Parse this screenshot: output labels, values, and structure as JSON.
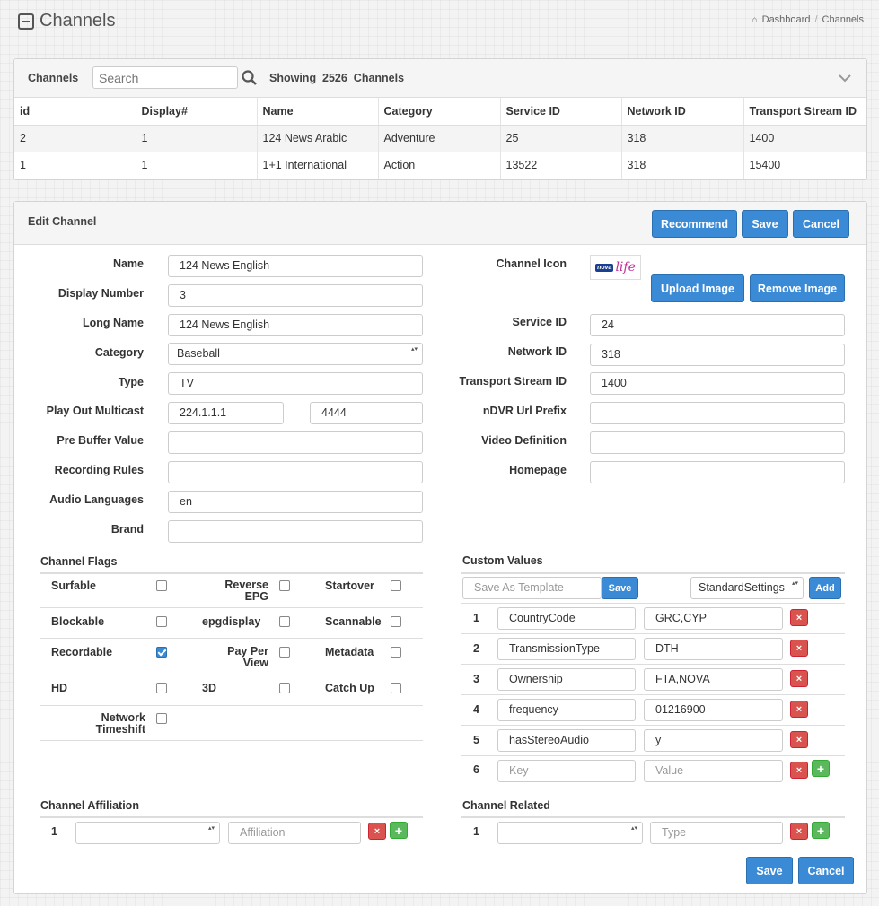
{
  "page": {
    "title": "Channels",
    "breadcrumb": [
      "Dashboard",
      "Channels"
    ]
  },
  "list": {
    "label": "Channels",
    "search_placeholder": "Search",
    "showing": "Showing",
    "count": "2526",
    "count_suffix": "Channels",
    "columns": [
      "id",
      "Display#",
      "Name",
      "Category",
      "Service ID",
      "Network ID",
      "Transport Stream ID"
    ],
    "rows": [
      [
        "2",
        "1",
        "124 News Arabic",
        "Adventure",
        "25",
        "318",
        "1400"
      ],
      [
        "1",
        "1",
        "1+1 International",
        "Action",
        "13522",
        "318",
        "15400"
      ]
    ]
  },
  "edit": {
    "title": "Edit Channel",
    "buttons": {
      "recommend": "Recommend",
      "save": "Save",
      "cancel": "Cancel",
      "upload": "Upload Image",
      "remove": "Remove Image"
    },
    "left_fields": {
      "name": {
        "label": "Name",
        "value": "124 News English"
      },
      "display_number": {
        "label": "Display Number",
        "value": "3"
      },
      "long_name": {
        "label": "Long Name",
        "value": "124 News English"
      },
      "category": {
        "label": "Category",
        "value": "Baseball"
      },
      "type": {
        "label": "Type",
        "value": "TV"
      },
      "multicast": {
        "label": "Play Out Multicast",
        "value": "224.1.1.1",
        "port": "4444"
      },
      "pre_buffer": {
        "label": "Pre Buffer Value",
        "value": ""
      },
      "recording_rules": {
        "label": "Recording Rules",
        "value": ""
      },
      "audio_languages": {
        "label": "Audio Languages",
        "value": "en"
      },
      "brand": {
        "label": "Brand",
        "value": ""
      }
    },
    "right_fields": {
      "channel_icon": {
        "label": "Channel Icon",
        "logo_a": "nova",
        "logo_b": "life"
      },
      "service_id": {
        "label": "Service ID",
        "value": "24"
      },
      "network_id": {
        "label": "Network ID",
        "value": "318"
      },
      "transport_stream_id": {
        "label": "Transport Stream ID",
        "value": "1400"
      },
      "ndvr": {
        "label": "nDVR Url Prefix",
        "value": ""
      },
      "video_definition": {
        "label": "Video Definition",
        "value": ""
      },
      "homepage": {
        "label": "Homepage",
        "value": ""
      }
    },
    "flags": {
      "title": "Channel Flags",
      "items": [
        {
          "label": "Surfable",
          "checked": false
        },
        {
          "label": "Reverse EPG",
          "checked": false
        },
        {
          "label": "Startover",
          "checked": false
        },
        {
          "label": "Blockable",
          "checked": false
        },
        {
          "label": "epgdisplay",
          "checked": false
        },
        {
          "label": "Scannable",
          "checked": false
        },
        {
          "label": "Recordable",
          "checked": true
        },
        {
          "label": "Pay Per View",
          "checked": false
        },
        {
          "label": "Metadata",
          "checked": false
        },
        {
          "label": "HD",
          "checked": false
        },
        {
          "label": "3D",
          "checked": false
        },
        {
          "label": "Catch Up",
          "checked": false
        },
        {
          "label": "Network Timeshift",
          "checked": false
        }
      ]
    },
    "custom": {
      "title": "Custom Values",
      "template_placeholder": "Save As Template",
      "save": "Save",
      "settings_select": "StandardSettings",
      "add": "Add",
      "rows": [
        {
          "n": "1",
          "key": "CountryCode",
          "value": "GRC,CYP"
        },
        {
          "n": "2",
          "key": "TransmissionType",
          "value": "DTH"
        },
        {
          "n": "3",
          "key": "Ownership",
          "value": "FTA,NOVA"
        },
        {
          "n": "4",
          "key": "frequency",
          "value": "01216900"
        },
        {
          "n": "5",
          "key": "hasStereoAudio",
          "value": "y"
        },
        {
          "n": "6",
          "key_placeholder": "Key",
          "value_placeholder": "Value"
        }
      ]
    },
    "affiliation": {
      "title": "Channel Affiliation",
      "n": "1",
      "select": "",
      "placeholder": "Affiliation"
    },
    "related": {
      "title": "Channel Related",
      "n": "1",
      "select": "",
      "placeholder": "Type"
    },
    "icons": {
      "remove": "×",
      "add": "+"
    }
  }
}
